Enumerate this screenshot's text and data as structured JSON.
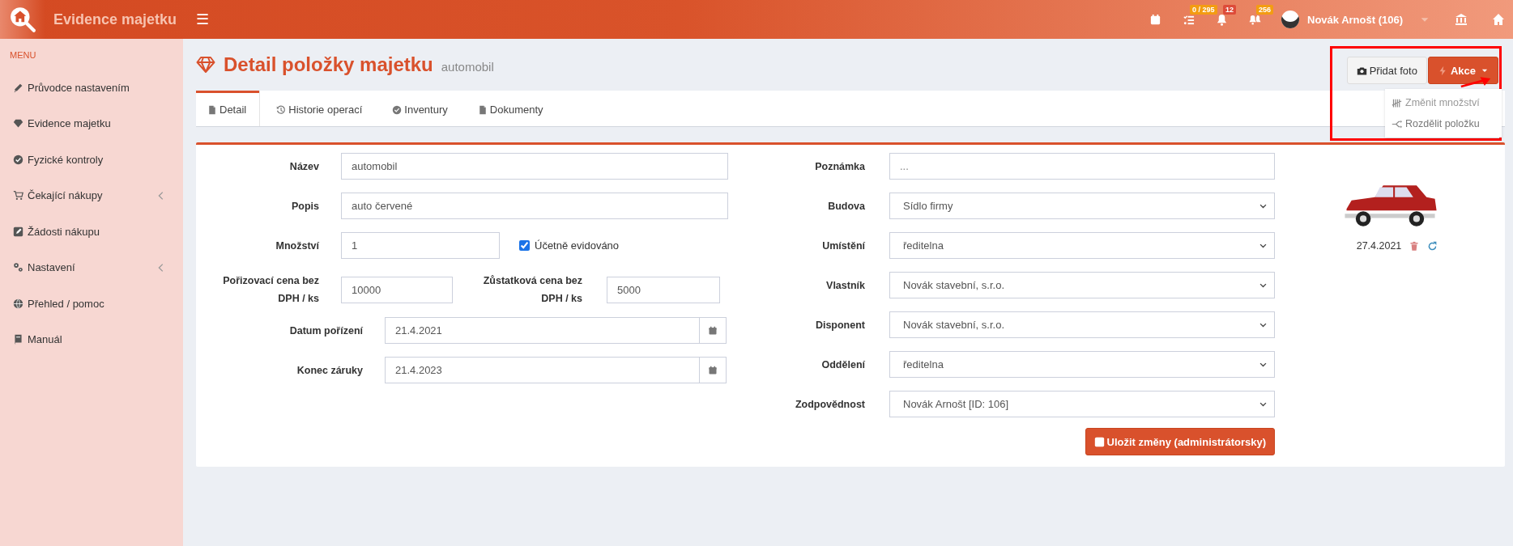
{
  "header": {
    "brand": "Evidence majetku",
    "menu_glyph": "☰",
    "icons": [
      {
        "kind": "calendar"
      },
      {
        "kind": "tasks",
        "badge": "0 / 295",
        "color": "#f39c12"
      },
      {
        "kind": "bell",
        "badge": "12",
        "color": "#dd4b39"
      },
      {
        "kind": "bells",
        "badge": "256",
        "color": "#f39c12"
      }
    ],
    "user": "Novák Arnošt (106)",
    "end_icons": [
      {
        "kind": "bank"
      },
      {
        "kind": "home"
      }
    ]
  },
  "sidebar": {
    "heading": "MENU",
    "items": [
      {
        "kind": "pencil",
        "label": "Průvodce nastavením",
        "has_submenu": false
      },
      {
        "kind": "diamond",
        "label": "Evidence majetku",
        "has_submenu": false
      },
      {
        "kind": "check",
        "label": "Fyzické kontroly",
        "has_submenu": false
      },
      {
        "kind": "cart",
        "label": "Čekající nákupy",
        "has_submenu": true
      },
      {
        "kind": "edit",
        "label": "Žádosti nákupu",
        "has_submenu": false
      },
      {
        "kind": "gears",
        "label": "Nastavení",
        "has_submenu": true
      },
      {
        "kind": "globe",
        "label": "Přehled / pomoc",
        "has_submenu": false
      },
      {
        "kind": "book",
        "label": "Manuál",
        "has_submenu": false
      }
    ]
  },
  "page": {
    "title": "Detail položky majetku",
    "subtitle": "automobil",
    "photo_button": "Přidat foto",
    "action_button": "Akce",
    "action_menu": [
      {
        "kind": "tally",
        "label": "Změnit množství",
        "disabled": true
      },
      {
        "kind": "split",
        "label": "Rozdělit položku",
        "disabled": false
      }
    ]
  },
  "tabs": [
    {
      "kind": "file",
      "label": "Detail",
      "selected": true
    },
    {
      "kind": "history",
      "label": "Historie operací",
      "selected": false
    },
    {
      "kind": "check",
      "label": "Inventury",
      "selected": false
    },
    {
      "kind": "file",
      "label": "Dokumenty",
      "selected": false
    }
  ],
  "form": {
    "left": [
      {
        "kind": "text",
        "label": "Název",
        "value": "automobil"
      },
      {
        "kind": "text",
        "label": "Popis",
        "value": "auto červené"
      },
      {
        "kind": "quantity",
        "label": "Množství",
        "value": "1",
        "checkbox_label": "Účetně evidováno",
        "checked": true
      },
      {
        "kind": "pair",
        "label": "Pořizovací cena bez DPH / ks",
        "value": "10000",
        "label2": "Zůstatková cena bez DPH / ks",
        "value2": "5000"
      },
      {
        "kind": "date",
        "label": "Datum pořízení",
        "value": "21.4.2021"
      },
      {
        "kind": "date",
        "label": "Konec záruky",
        "value": "21.4.2023"
      }
    ],
    "right": [
      {
        "kind": "text",
        "label": "Poznámka",
        "placeholder": "..."
      },
      {
        "kind": "select",
        "label": "Budova",
        "value": "Sídlo firmy"
      },
      {
        "kind": "select",
        "label": "Umístění",
        "value": "ředitelna"
      },
      {
        "kind": "select",
        "label": "Vlastník",
        "value": "Novák stavební, s.r.o."
      },
      {
        "kind": "select",
        "label": "Disponent",
        "value": "Novák stavební, s.r.o."
      },
      {
        "kind": "select",
        "label": "Oddělení",
        "value": "ředitelna"
      },
      {
        "kind": "select",
        "label": "Zodpovědnost",
        "value": "Novák Arnošt [ID: 106]"
      }
    ],
    "save_button": "Uložit změny (administrátorsky)"
  },
  "photo": {
    "date": "27.4.2021"
  }
}
